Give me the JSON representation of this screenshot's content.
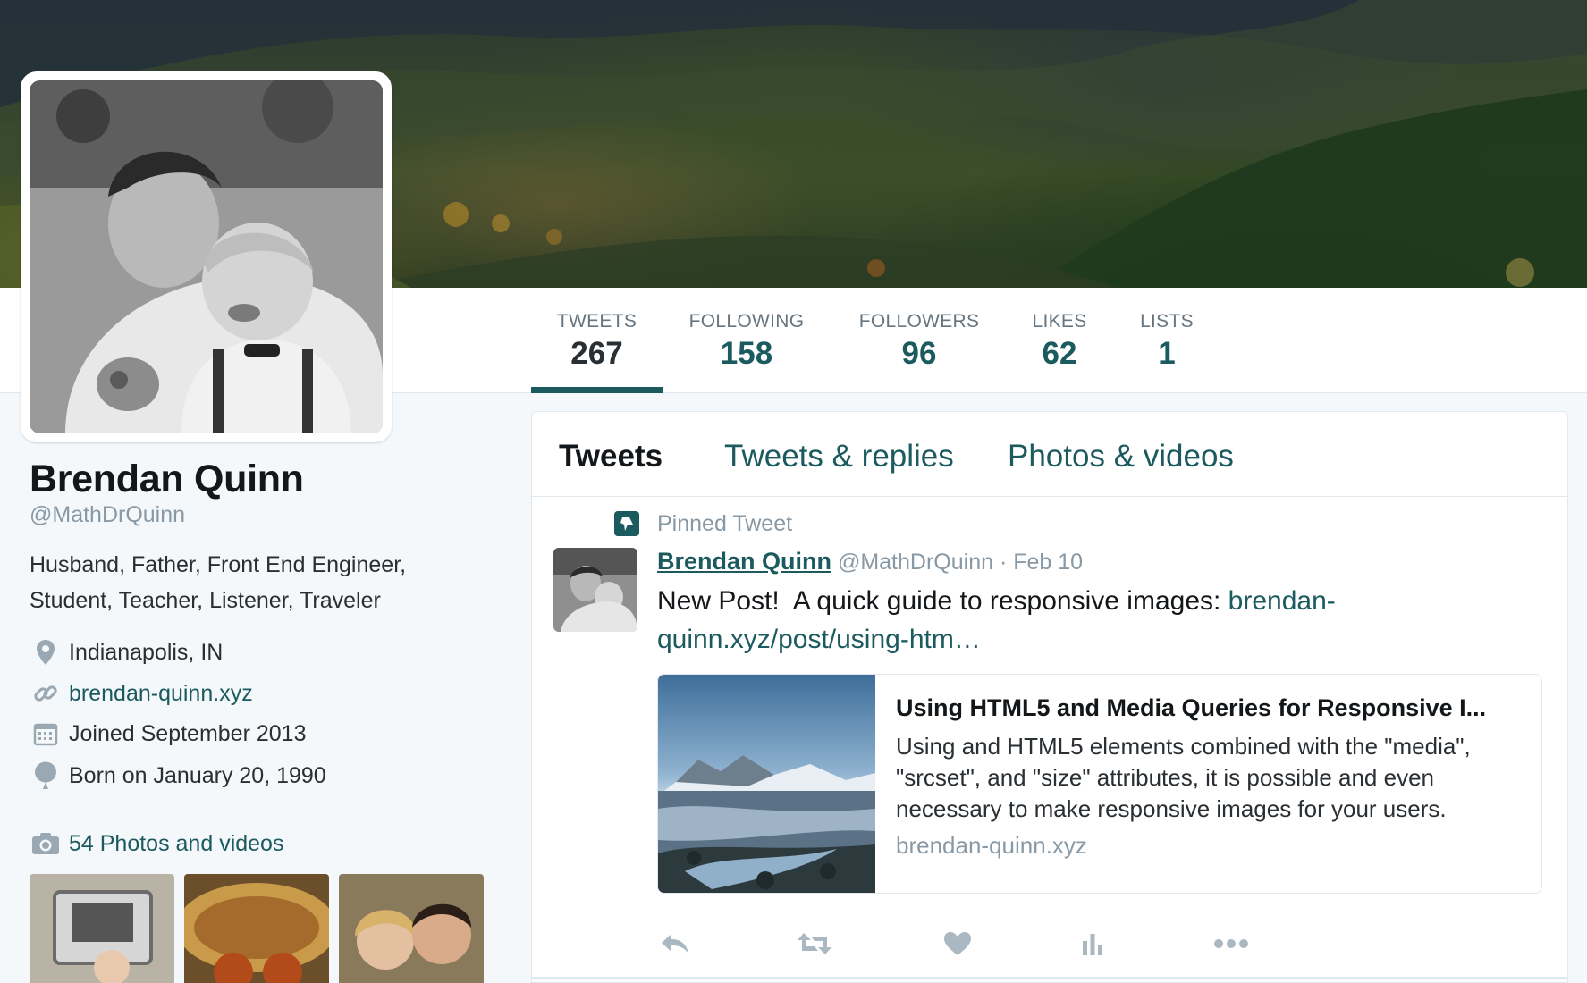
{
  "stats": [
    {
      "label": "TWEETS",
      "value": "267"
    },
    {
      "label": "FOLLOWING",
      "value": "158"
    },
    {
      "label": "FOLLOWERS",
      "value": "96"
    },
    {
      "label": "LIKES",
      "value": "62"
    },
    {
      "label": "LISTS",
      "value": "1"
    }
  ],
  "profile": {
    "name": "Brendan Quinn",
    "handle": "@MathDrQuinn",
    "bio_line1": "Husband, Father, Front End Engineer,",
    "bio_line2": "Student, Teacher, Listener, Traveler",
    "location": "Indianapolis, IN",
    "website": "brendan-quinn.xyz",
    "joined": "Joined September 2013",
    "born": "Born on January 20, 1990",
    "photos_link": "54 Photos and videos"
  },
  "tabs": [
    "Tweets",
    "Tweets & replies",
    "Photos & videos"
  ],
  "pinned": {
    "label": "Pinned Tweet",
    "author_name": "Brendan Quinn",
    "author_handle": "@MathDrQuinn",
    "separator": "·",
    "date": "Feb 10",
    "text": "New Post!  A quick guide to responsive images: ",
    "link_part1": "brendan-",
    "link_part2": "quinn.xyz/post/using-htm…",
    "card": {
      "title": "Using HTML5 and Media Queries for Responsive I...",
      "description": "Using and HTML5 elements combined with the \"media\", \"srcset\", and \"size\" attributes, it is possible and even necessary to make responsive images for your users.",
      "domain": "brendan-quinn.xyz"
    }
  },
  "colors": {
    "accent": "#1b5a5e",
    "muted": "#8899a6",
    "background": "#f5f8fa"
  },
  "icons": [
    "location-icon",
    "link-icon",
    "calendar-icon",
    "balloon-icon",
    "camera-icon",
    "pin-icon",
    "reply-icon",
    "retweet-icon",
    "like-icon",
    "analytics-icon",
    "more-icon"
  ]
}
